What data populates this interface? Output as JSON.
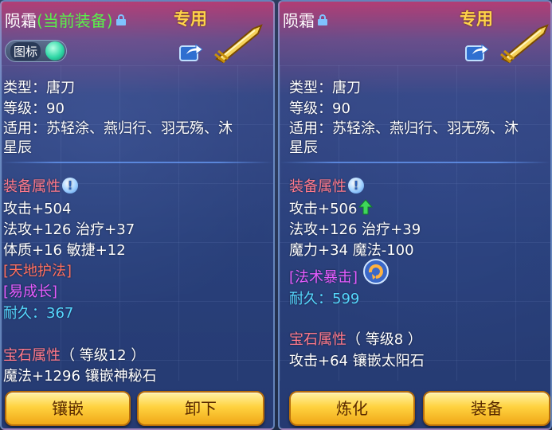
{
  "left": {
    "name": "陨霜",
    "current_tag": "(当前装备)",
    "special": "专用",
    "toggle_label": "图标",
    "lines": {
      "type": "类型：唐刀",
      "level": "等级：90",
      "fit1": "适用：苏轻涂、燕归行、羽无殇、沐",
      "fit2": "星辰",
      "attr_header": "装备属性",
      "attack": "攻击+504",
      "magic": "法攻+126 治疗+37",
      "body": "体质+16 敏捷+12",
      "skill1": "[天地护法]",
      "skill2": "[易成长]",
      "durability_label": "耐久：",
      "durability_value": "367",
      "gem_header": "宝石属性",
      "gem_level": "（ 等级12 ）",
      "gem_effect": "魔法+1296 镶嵌神秘石"
    },
    "buttons": [
      "镶嵌",
      "卸下"
    ]
  },
  "right": {
    "name": "陨霜",
    "special": "专用",
    "lines": {
      "type": "类型：唐刀",
      "level": "等级：90",
      "fit1": "适用：苏轻涂、燕归行、羽无殇、沐",
      "fit2": "星辰",
      "attr_header": "装备属性",
      "attack": "攻击+506",
      "magic": "法攻+126 治疗+39",
      "mana": "魔力+34 魔法-100",
      "skill1": "[法术暴击]",
      "durability_label": "耐久：",
      "durability_value": "599",
      "gem_header": "宝石属性",
      "gem_level": "（ 等级8 ）",
      "gem_effect": "攻击+64 镶嵌太阳石"
    },
    "buttons": [
      "炼化",
      "装备"
    ]
  },
  "icons": [
    "lock-icon",
    "share-icon",
    "weapon-blade-icon",
    "info-icon",
    "up-arrow-icon",
    "refresh-icon"
  ]
}
